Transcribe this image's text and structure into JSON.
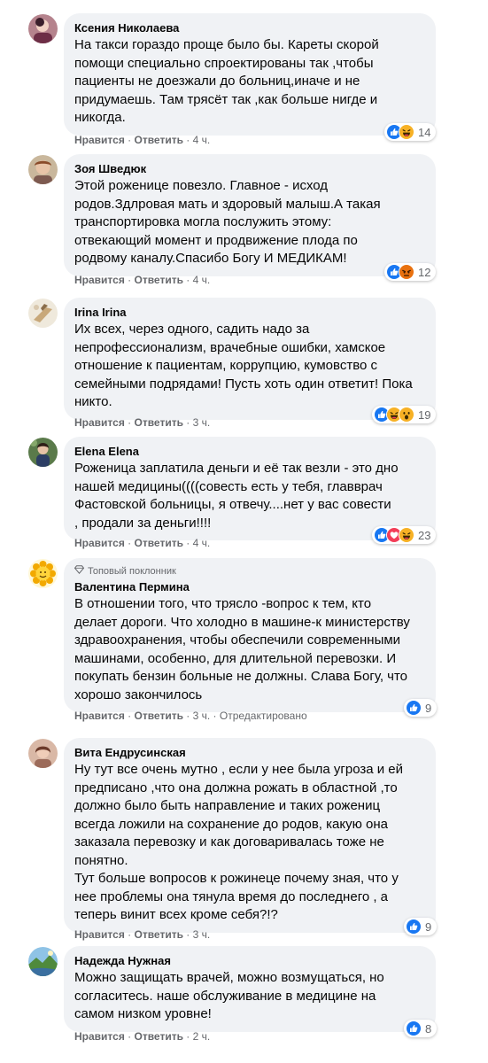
{
  "actions": {
    "like": "Нравится",
    "reply": "Ответить",
    "sep": " · "
  },
  "comments": [
    {
      "name": "Ксения Николаева",
      "text": "На такси гораздо проще было бы. Кареты скорой\nпомощи специально спроектированы так ,чтобы\nпациенты не доезжали до больниц,иначе и не\nпридумаешь. Там трясёт так ,как больше нигде и\nникогда.",
      "time": "4 ч.",
      "reaction_count": "14",
      "reactions": [
        "like",
        "haha"
      ]
    },
    {
      "name": "Зоя Шведюк",
      "text": "Этой роженице повезло. Главное - исход\nродов.Здлровая мать и здоровый малыш.А такая\nтранспортировка могла послужить этому:\nотвекающий момент и продвижение плода по\nродвому каналу.Спасибо Богу И МЕДИКАМ!",
      "time": "4 ч.",
      "reaction_count": "12",
      "reactions": [
        "like",
        "angry"
      ]
    },
    {
      "name": "Irina Irina",
      "text": "Их всех, через одного, садить надо за\nнепрофессионализм, врачебные ошибки, хамское\nотношение к пациентам, коррупцию, кумовство с\nсемейными подрядами! Пусть хоть один ответит! Пока\nникто.",
      "time": "3 ч.",
      "reaction_count": "19",
      "reactions": [
        "like",
        "haha",
        "wow"
      ]
    },
    {
      "name": "Elena Elena",
      "text": "Роженица заплатила деньги и её так везли - это дно\nнашей медицины((((совесть есть у тебя, главврач\nФастовской больницы, я отвечу....нет у вас совести\n, продали за деньги!!!!",
      "time": "4 ч.",
      "reaction_count": "23",
      "reactions": [
        "like",
        "love",
        "haha"
      ]
    },
    {
      "badge": "Топовый поклонник",
      "name": "Валентина Пермина",
      "text": "В отношении того, что трясло -вопрос к тем, кто\nделает дороги. Что холодно в машине-к министерству\nздравоохранения, чтобы обеспечили современными\nмашинами, особенно, для длительной перевозки. И\nпокупать бензин больные не должны. Слава Богу, что\nхорошо закончилось",
      "time": "3 ч.",
      "edited": "Отредактировано",
      "reaction_count": "9",
      "reactions": [
        "like"
      ]
    },
    {
      "name": "Вита Ендрусинская",
      "text": "Ну тут все очень мутно , если у нее была угроза и ей\nпредписано ,что она должна рожать в областной ,то\nдолжно было быть направление и таких рожениц\nвсегда ложили на сохранение до родов, какую она\nзаказала перевозку и как договаривалась тоже не\nпонятно.\nТут больше вопросов к рожинеце почему зная, что у\nнее проблемы она тянула время до последнего , а\nтеперь винит всех кроме себя?!?",
      "time": "3 ч.",
      "reaction_count": "9",
      "reactions": [
        "like"
      ]
    },
    {
      "name": "Надежда Нужная",
      "text": "Можно защищать врачей, можно возмущаться, но\nсогласитесь. наше обслуживание в медицине на\nсамом низком уровне!",
      "time": "2 ч.",
      "reaction_count": "8",
      "reactions": [
        "like"
      ]
    }
  ],
  "colors": {
    "like": "#1877f2",
    "love": "#f33e58",
    "haha": "#f7b125",
    "angry": "#e9710f",
    "bubble": "#f0f2f5",
    "meta": "#65676b"
  }
}
